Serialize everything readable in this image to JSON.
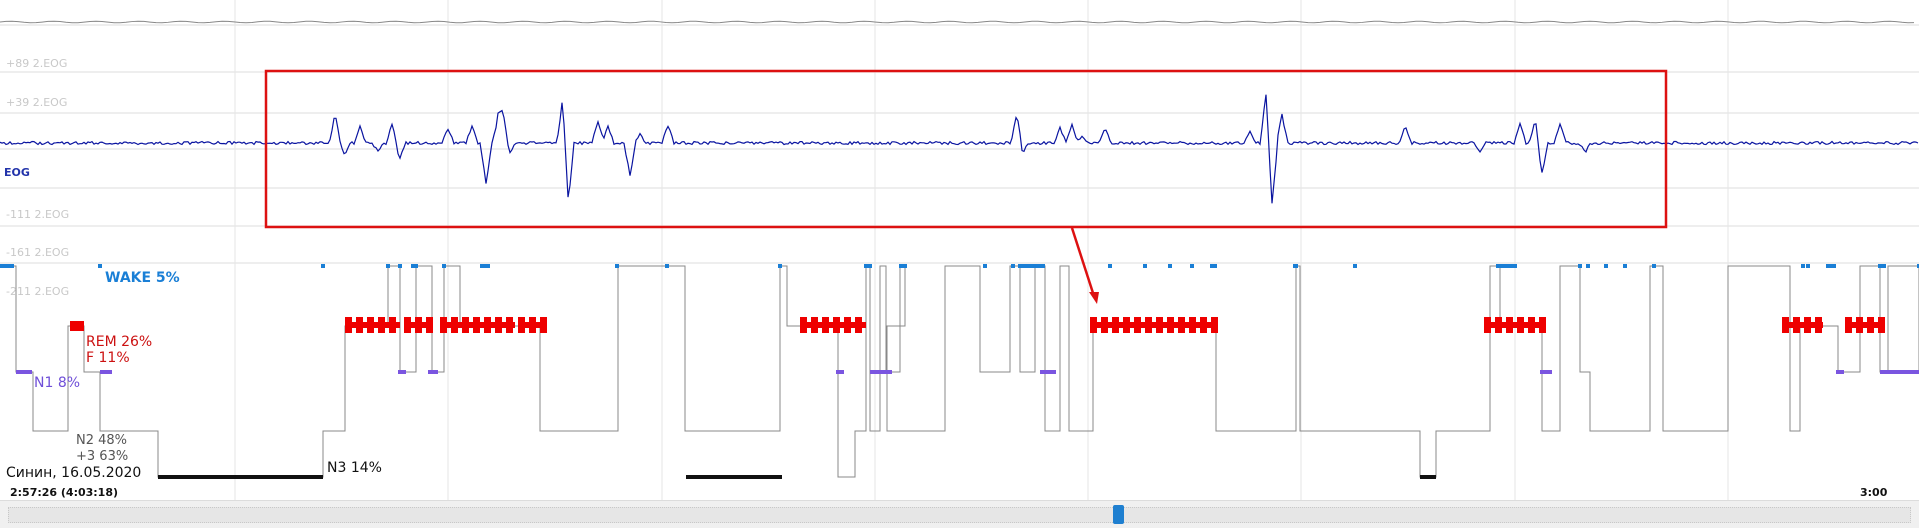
{
  "channel": {
    "name": "EOG",
    "scale_labels": [
      "+89 2.EOG",
      "+39 2.EOG",
      "-111 2.EOG",
      "-161 2.EOG",
      "-211 2.EOG"
    ]
  },
  "hypnogram": {
    "wake": "WAKE 5%",
    "rem": "REM 26%",
    "f": "F 11%",
    "n1": "N1 8%",
    "n2": "N2 48%",
    "n2_sub": "+3 63%",
    "n3": "N3 14%"
  },
  "status": {
    "patient": "Синин, 16.05.2020",
    "time_info": "2:57:26 (4:03:18)",
    "end_time": "3:00"
  },
  "scrollbar": {
    "position_fraction": 0.58
  },
  "colors": {
    "eog_signal": "#0a14a0",
    "highlight_box": "#dd1111",
    "wake": "#1a7fd6",
    "rem": "#ee0000",
    "n1": "#7a55e0",
    "n2": "#777777",
    "n3": "#111111",
    "scroll_thumb": "#1e7fd0"
  }
}
